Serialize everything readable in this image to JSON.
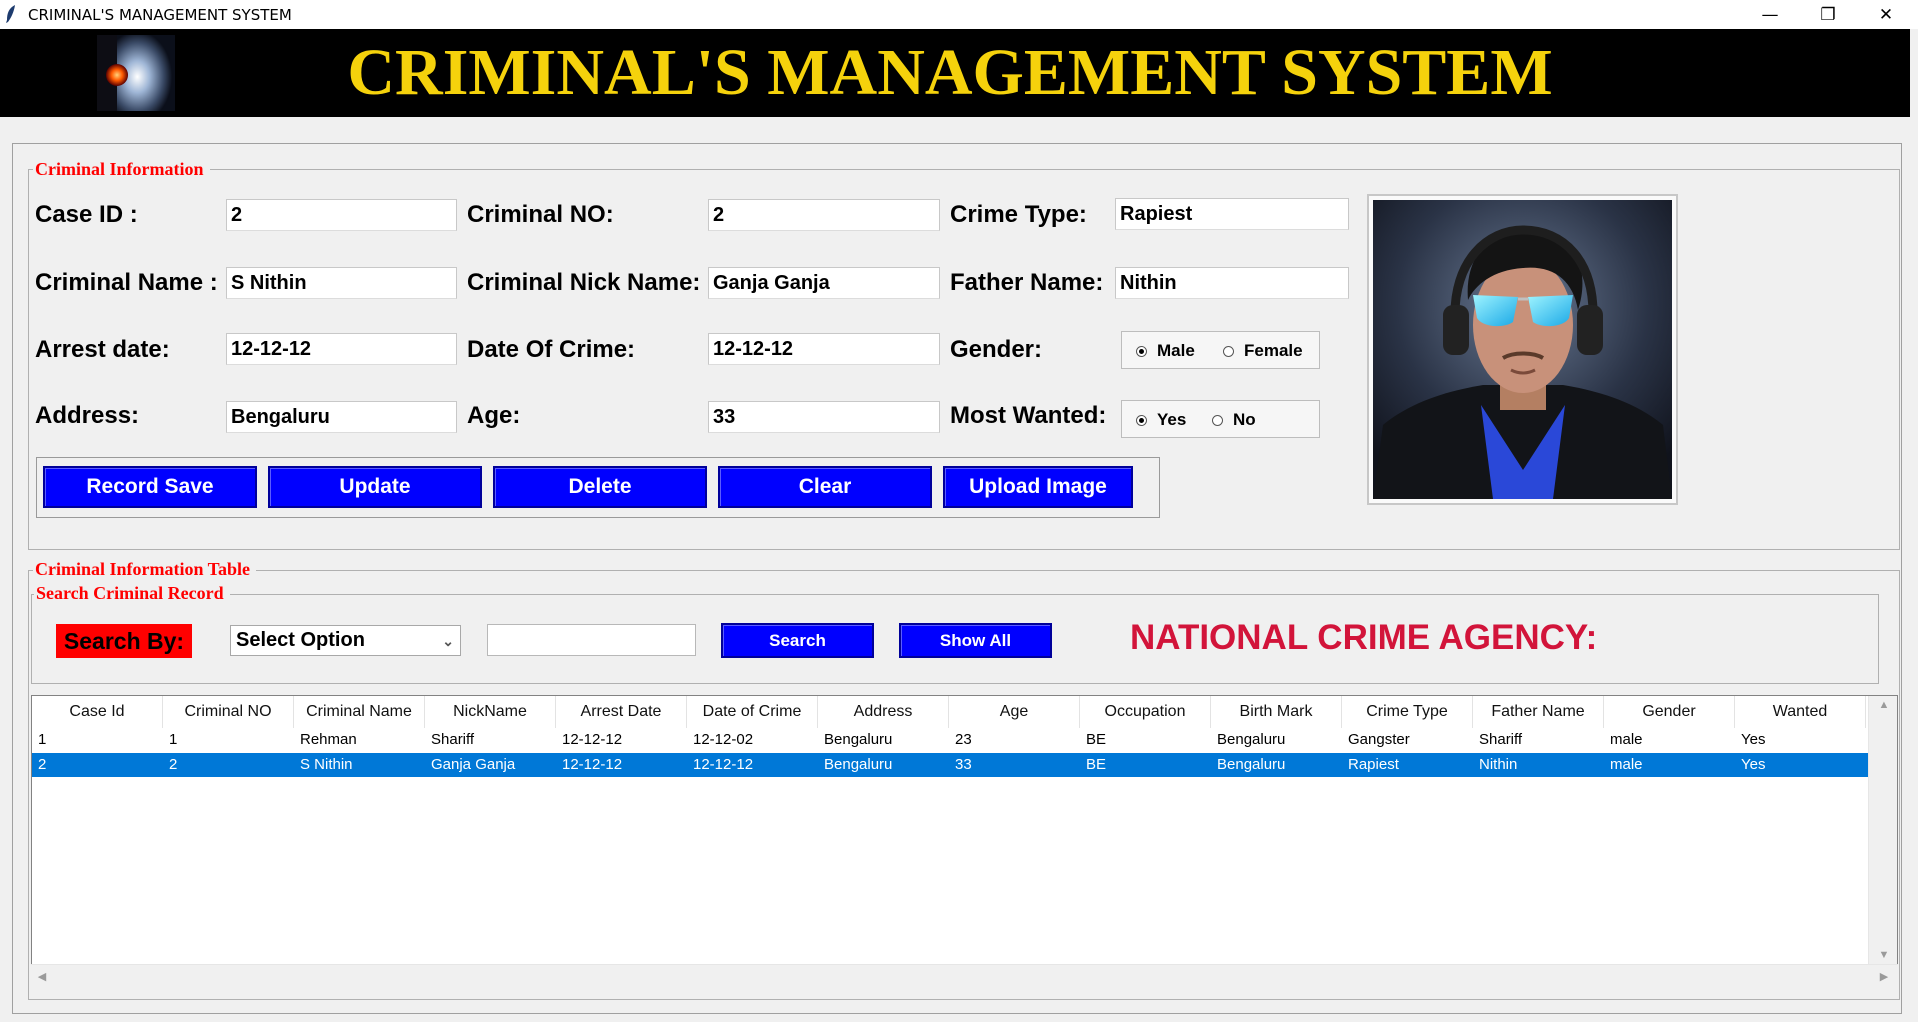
{
  "window": {
    "title": "CRIMINAL'S MANAGEMENT SYSTEM",
    "minimize": "—",
    "restore": "❐",
    "close": "✕"
  },
  "banner": {
    "title": "CRIMINAL'S MANAGEMENT SYSTEM"
  },
  "criminal_info": {
    "legend": "Criminal Information",
    "fields": {
      "case_id": {
        "label": "Case ID :",
        "value": "2"
      },
      "criminal_no": {
        "label": "Criminal NO:",
        "value": "2"
      },
      "crime_type": {
        "label": "Crime Type:",
        "value": "Rapiest"
      },
      "criminal_name": {
        "label": "Criminal Name :",
        "value": "S Nithin"
      },
      "nick_name": {
        "label": "Criminal Nick Name:",
        "value": "Ganja Ganja"
      },
      "father_name": {
        "label": "Father Name:",
        "value": "Nithin"
      },
      "arrest_date": {
        "label": "Arrest date:",
        "value": "12-12-12"
      },
      "date_of_crime": {
        "label": "Date Of Crime:",
        "value": "12-12-12"
      },
      "address": {
        "label": "Address:",
        "value": "Bengaluru"
      },
      "age": {
        "label": "Age:",
        "value": "33"
      }
    },
    "gender": {
      "label": "Gender:",
      "options": [
        "Male",
        "Female"
      ],
      "selected": "Male"
    },
    "most_wanted": {
      "label": "Most Wanted:",
      "options": [
        "Yes",
        "No"
      ],
      "selected": "Yes"
    },
    "buttons": {
      "save": "Record Save",
      "update": "Update",
      "delete": "Delete",
      "clear": "Clear",
      "upload": "Upload Image"
    }
  },
  "table_section": {
    "legend": "Criminal Information Table",
    "search_legend": "Search Criminal Record",
    "search_by_label": "Search By:",
    "select_value": "Select Option",
    "search_text": "",
    "search_button": "Search",
    "show_all_button": "Show All",
    "agency_title": "NATIONAL CRIME AGENCY:"
  },
  "table": {
    "columns": [
      "Case Id",
      "Criminal NO",
      "Criminal Name",
      "NickName",
      "Arrest Date",
      "Date of Crime",
      "Address",
      "Age",
      "Occupation",
      "Birth Mark",
      "Crime Type",
      "Father Name",
      "Gender",
      "Wanted"
    ],
    "rows": [
      [
        "1",
        "1",
        "Rehman",
        "Shariff",
        "12-12-12",
        "12-12-02",
        "Bengaluru",
        "23",
        "BE",
        "Bengaluru",
        "Gangster",
        "Shariff",
        "male",
        "Yes"
      ],
      [
        "2",
        "2",
        "S Nithin",
        "Ganja Ganja",
        "12-12-12",
        "12-12-12",
        "Bengaluru",
        "33",
        "BE",
        "Bengaluru",
        "Rapiest",
        "Nithin",
        "male",
        "Yes"
      ]
    ],
    "selected_row": 1
  },
  "colors": {
    "banner_bg": "#000000",
    "banner_text": "#f5d20c",
    "legend_text": "#ff0000",
    "button_bg": "#0000ff",
    "search_by_bg": "#ff0000",
    "agency_text": "#d2143a",
    "selection": "#0078d7"
  }
}
